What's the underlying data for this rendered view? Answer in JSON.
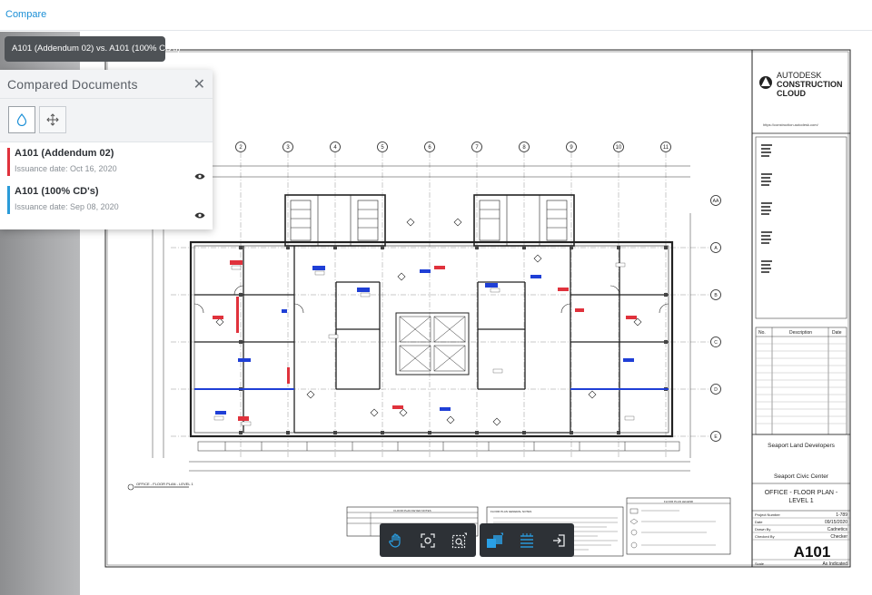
{
  "topbar": {
    "link": "Compare"
  },
  "tooltip": {
    "text": "A101 (Addendum 02) vs. A101 (100% CD's)"
  },
  "panel": {
    "title": "Compared Documents",
    "close_icon": "close-icon",
    "tools": [
      {
        "icon": "droplet-icon",
        "active": true
      },
      {
        "icon": "move-icon",
        "active": false
      }
    ],
    "documents": [
      {
        "name": "A101 (Addendum 02)",
        "date": "Issuance date: Oct 16, 2020",
        "color": "#e0323c"
      },
      {
        "name": "A101 (100% CD's)",
        "date": "Issuance date: Sep 08, 2020",
        "color": "#2a9bd8"
      }
    ]
  },
  "titleblock": {
    "brand_line1": "AUTODESK",
    "brand_line2": "CONSTRUCTION",
    "brand_line3": "CLOUD",
    "url": "https://construction.autodesk.com/",
    "rev_headers": [
      "No.",
      "Description",
      "Date"
    ],
    "client": "Seaport Land Developers",
    "project": "Seaport Civic Center",
    "sheet_title_1": "OFFICE - FLOOR PLAN -",
    "sheet_title_2": "LEVEL 1",
    "fields": [
      {
        "label": "Project Number",
        "value": "1-789"
      },
      {
        "label": "Date",
        "value": "09/15/2020"
      },
      {
        "label": "Drawn By",
        "value": "Cadnetics"
      },
      {
        "label": "Checked By",
        "value": "Checker"
      }
    ],
    "sheet_number": "A101",
    "scale_label": "Scale",
    "scale_value": "As Indicated"
  },
  "drawing": {
    "grid_columns": [
      "2",
      "3",
      "4",
      "5",
      "6",
      "7",
      "8",
      "9",
      "10",
      "11"
    ],
    "grid_rows": [
      "AA",
      "A",
      "B",
      "C",
      "D",
      "E"
    ],
    "view_title": "OFFICE - FLOOR PLAN - LEVEL 1",
    "notes_title": "FLOOR PLAN KEYED NOTES",
    "general_notes_title": "FLOOR PLAN GENERAL NOTES",
    "legend_title": "FLOOR PLAN LEGEND",
    "accent_red": "#e0323c",
    "accent_blue": "#1f3fd6"
  },
  "toolbar": {
    "left": [
      {
        "icon": "pan-hand-icon"
      },
      {
        "icon": "fit-view-icon"
      },
      {
        "icon": "zoom-window-icon"
      }
    ],
    "right": [
      {
        "icon": "overlay-compare-icon"
      },
      {
        "icon": "layers-icon"
      },
      {
        "icon": "exit-compare-icon"
      }
    ]
  }
}
